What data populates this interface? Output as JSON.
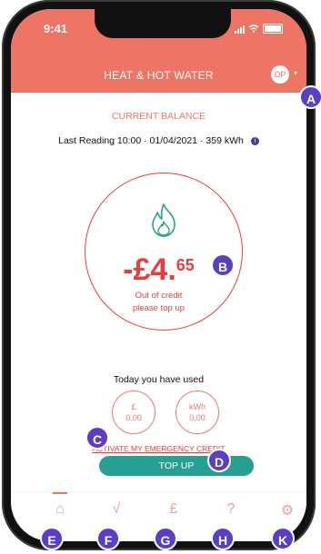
{
  "status_bar": {
    "time": "9:41"
  },
  "header": {
    "title": "HEAT & HOT WATER",
    "avatar_initials": "DP",
    "caret": "▾"
  },
  "balance_section": {
    "title": "CURRENT BALANCE",
    "last_reading": "Last Reading 10:00 · 01/04/2021 · 359 kWh",
    "info_glyph": "i",
    "balance_main": "-£4.",
    "balance_pence": "65",
    "status_line1": "Out of credit",
    "status_line2": "please top up"
  },
  "usage": {
    "title": "Today you have used",
    "money_unit": "£",
    "money_value": "0.00",
    "energy_unit": "kWh",
    "energy_value": "0.00"
  },
  "actions": {
    "emergency_credit": "ACTIVATE MY EMERGENCY CREDIT",
    "top_up": "TOP UP"
  },
  "tabs": [
    {
      "icon": "home-icon",
      "glyph": "⌂"
    },
    {
      "icon": "chart-icon",
      "glyph": "√"
    },
    {
      "icon": "pound-icon",
      "glyph": "£"
    },
    {
      "icon": "help-icon",
      "glyph": "?"
    },
    {
      "icon": "settings-icon",
      "glyph": "⚙"
    }
  ],
  "badges": {
    "a": "A",
    "b": "B",
    "c": "C",
    "d": "D",
    "e": "E",
    "f": "F",
    "g": "G",
    "h": "H",
    "k": "K"
  },
  "colors": {
    "header": "#ee7566",
    "alert_red": "#e53e3e",
    "button_teal": "#26a091",
    "badge_purple": "#5b3fc2"
  }
}
